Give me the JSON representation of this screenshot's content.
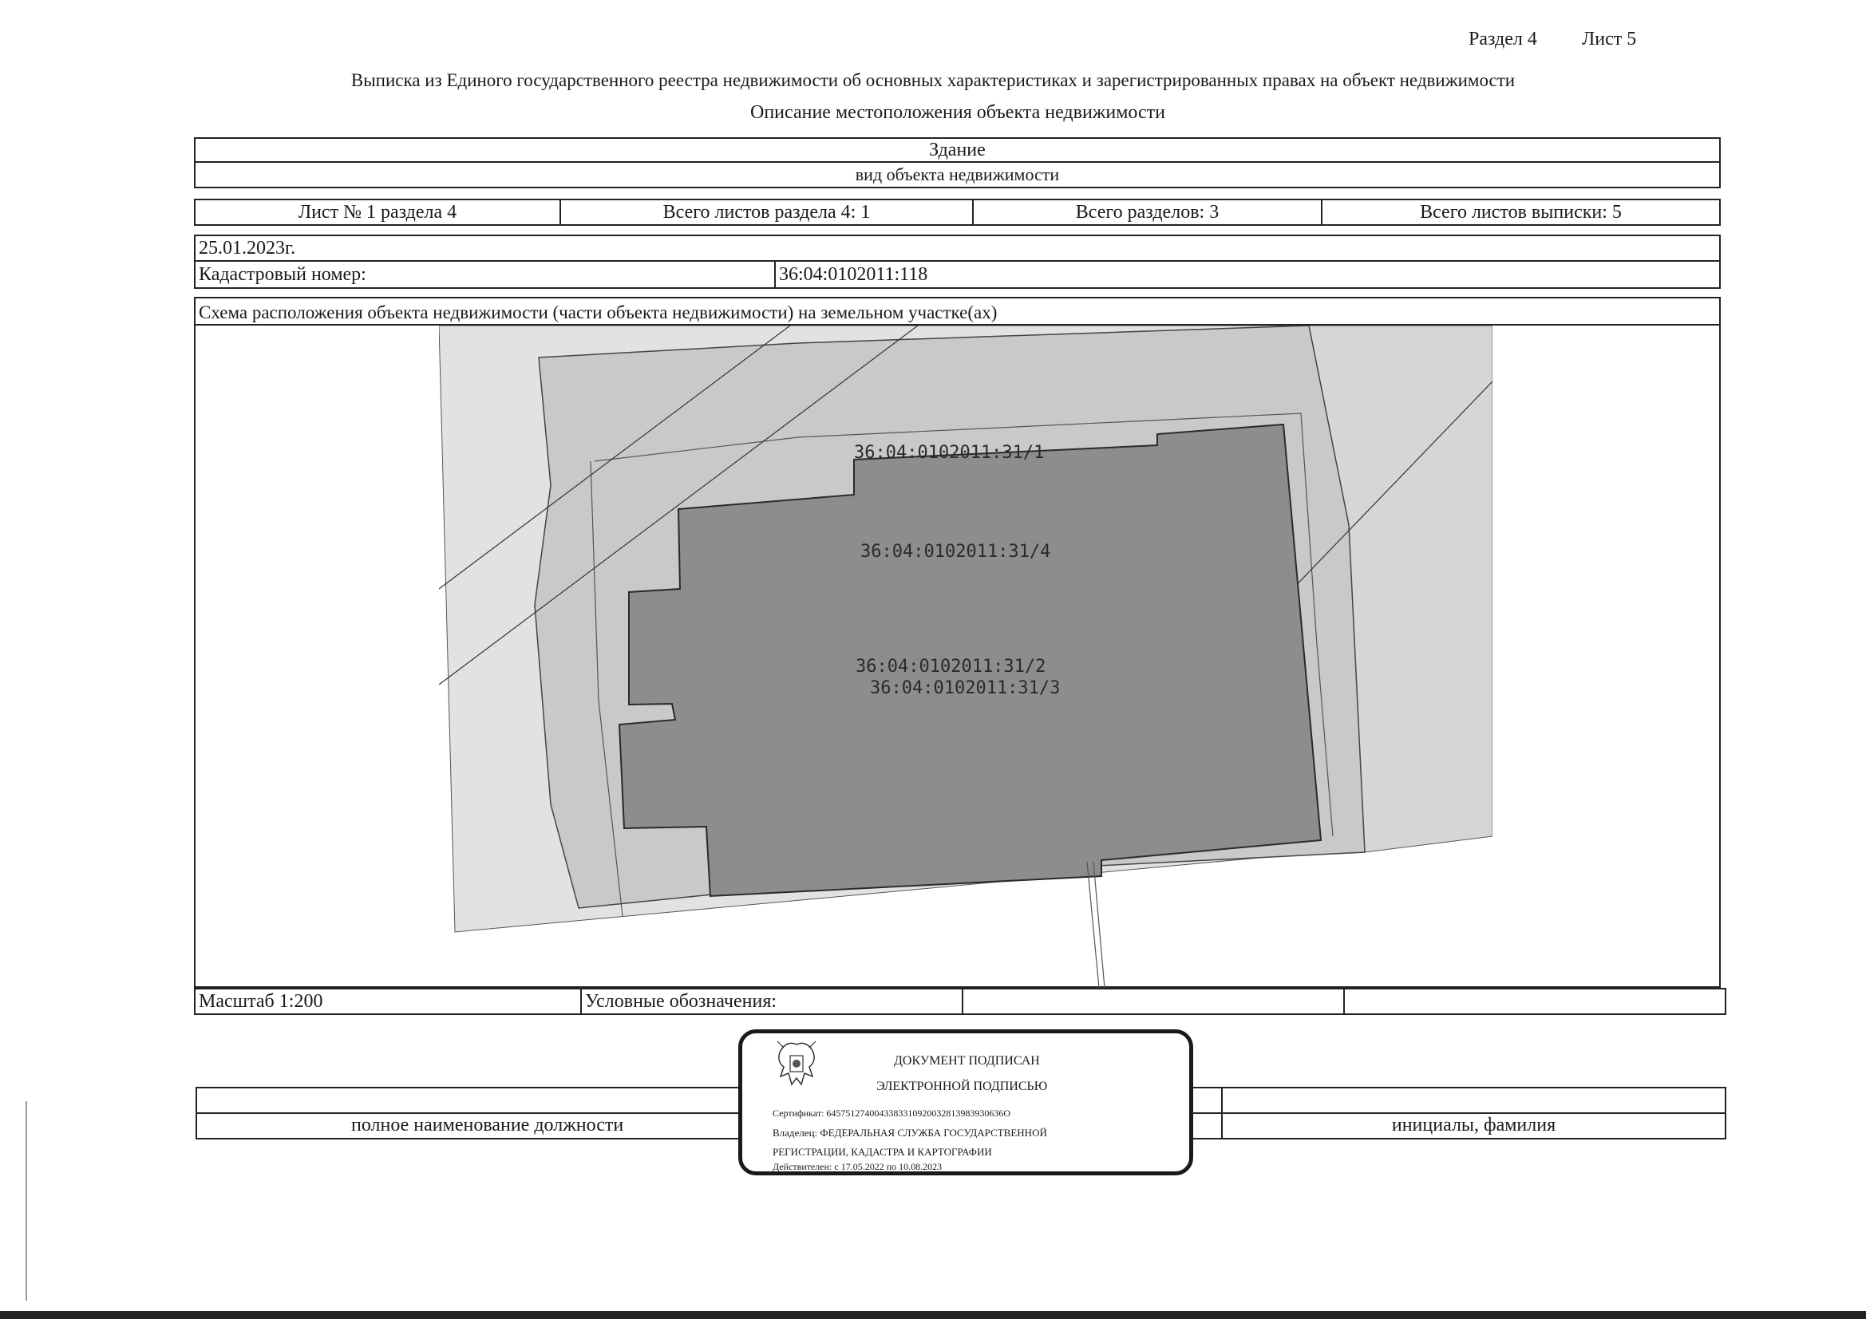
{
  "header": {
    "section": "Раздел 4",
    "sheet": "Лист 5"
  },
  "document": {
    "title": "Выписка из Единого государственного реестра недвижимости об основных характеристиках и зарегистрированных правах на объект недвижимости",
    "subtitle": "Описание местоположения объекта недвижимости"
  },
  "object": {
    "type_value": "Здание",
    "type_caption": "вид объекта недвижимости"
  },
  "sheets": {
    "sheet_of_section": "Лист № 1 раздела 4",
    "total_section_sheets": "Всего листов раздела 4: 1",
    "total_sections": "Всего разделов: 3",
    "total_extract_sheets": "Всего листов выписки: 5"
  },
  "info": {
    "date": "25.01.2023г.",
    "cadastral_label": "Кадастровый номер:",
    "cadastral_value": "36:04:0102011:118"
  },
  "scheme": {
    "title": "Схема расположения объекта недвижимости (части объекта недвижимости) на земельном участке(ах)",
    "labels": [
      "36:04:0102011:31/1",
      "36:04:0102011:31/4",
      "36:04:0102011:31/2",
      "36:04:0102011:31/3"
    ],
    "fill_building": "#8d8d8d",
    "fill_parcel": "#c9c9c9",
    "fill_outer": "#e2e2e2"
  },
  "legend": {
    "scale": "Масштаб 1:200",
    "symbols": "Условные обозначения:"
  },
  "signature": {
    "position_caption": "полное наименование должности",
    "name_caption": "инициалы, фамилия"
  },
  "stamp": {
    "line1": "ДОКУМЕНТ ПОДПИСАН",
    "line2": "ЭЛЕКТРОННОЙ ПОДПИСЬЮ",
    "certificate": "Сертификат: 6457512740043383310920032813983930636О",
    "owner_line1": "Владелец: ФЕДЕРАЛЬНАЯ СЛУЖБА ГОСУДАРСТВЕННОЙ",
    "owner_line2": "РЕГИСТРАЦИИ, КАДАСТРА И КАРТОГРАФИИ",
    "valid": "Действителен: с 17.05.2022 по 10.08.2023"
  }
}
